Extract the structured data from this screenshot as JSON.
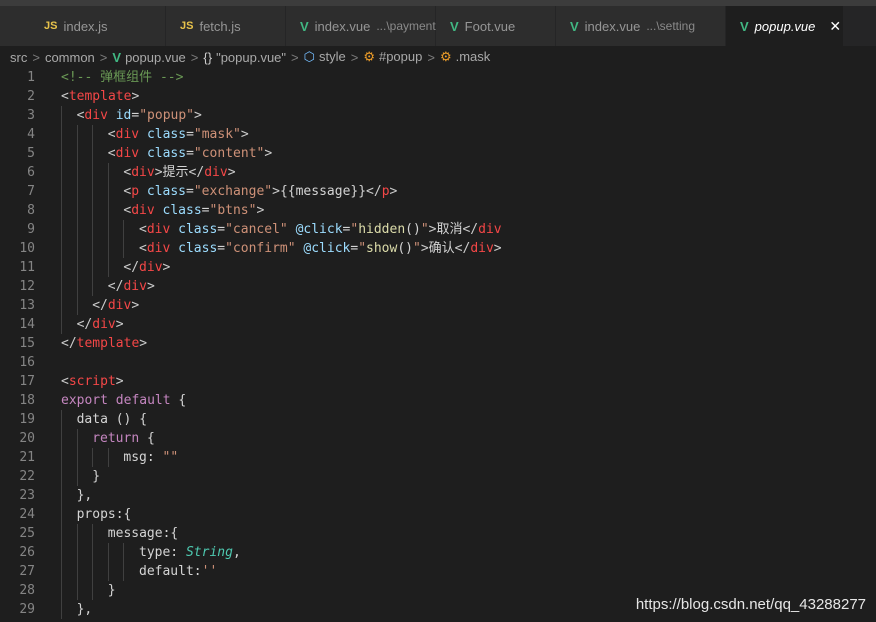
{
  "tabs": [
    {
      "icon": "JS",
      "kind": "js",
      "label": "index.js",
      "desc": "",
      "active": false
    },
    {
      "icon": "JS",
      "kind": "js",
      "label": "fetch.js",
      "desc": "",
      "active": false
    },
    {
      "icon": "V",
      "kind": "vue",
      "label": "index.vue",
      "desc": "...\\payment",
      "active": false
    },
    {
      "icon": "V",
      "kind": "vue",
      "label": "Foot.vue",
      "desc": "",
      "active": false
    },
    {
      "icon": "V",
      "kind": "vue",
      "label": "index.vue",
      "desc": "...\\setting",
      "active": false
    },
    {
      "icon": "V",
      "kind": "vue",
      "label": "popup.vue",
      "desc": "",
      "active": true,
      "close": "✕"
    }
  ],
  "breadcrumb": [
    {
      "label": "src",
      "icon": "",
      "kind": ""
    },
    {
      "label": "common",
      "icon": "",
      "kind": ""
    },
    {
      "label": "popup.vue",
      "icon": "V",
      "kind": "vue"
    },
    {
      "label": "\"popup.vue\"",
      "icon": "{}",
      "kind": "obj"
    },
    {
      "label": "style",
      "icon": "⬡",
      "kind": "cube"
    },
    {
      "label": "#popup",
      "icon": "⚙",
      "kind": "style"
    },
    {
      "label": ".mask",
      "icon": "⚙",
      "kind": "style"
    }
  ],
  "breadcrumb_sep": ">",
  "code_lines": [
    {
      "n": "1",
      "indent": 0,
      "tokens": [
        [
          "c",
          "<!-- 弹框组件 -->"
        ]
      ]
    },
    {
      "n": "2",
      "indent": 0,
      "tokens": [
        [
          "b",
          "<"
        ],
        [
          "t",
          "template"
        ],
        [
          "b",
          ">"
        ]
      ]
    },
    {
      "n": "3",
      "indent": 1,
      "tokens": [
        [
          "b",
          "<"
        ],
        [
          "t",
          "div"
        ],
        [
          "x",
          " "
        ],
        [
          "a",
          "id"
        ],
        [
          "x",
          "="
        ],
        [
          "s",
          "\"popup\""
        ],
        [
          "b",
          ">"
        ]
      ]
    },
    {
      "n": "4",
      "indent": 3,
      "tokens": [
        [
          "b",
          "<"
        ],
        [
          "t",
          "div"
        ],
        [
          "x",
          " "
        ],
        [
          "a",
          "class"
        ],
        [
          "x",
          "="
        ],
        [
          "s",
          "\"mask\""
        ],
        [
          "b",
          ">"
        ]
      ]
    },
    {
      "n": "5",
      "indent": 3,
      "tokens": [
        [
          "b",
          "<"
        ],
        [
          "t",
          "div"
        ],
        [
          "x",
          " "
        ],
        [
          "a",
          "class"
        ],
        [
          "x",
          "="
        ],
        [
          "s",
          "\"content\""
        ],
        [
          "b",
          ">"
        ]
      ]
    },
    {
      "n": "6",
      "indent": 4,
      "tokens": [
        [
          "b",
          "<"
        ],
        [
          "t",
          "div"
        ],
        [
          "b",
          ">"
        ],
        [
          "x",
          "提示"
        ],
        [
          "b",
          "</"
        ],
        [
          "t",
          "div"
        ],
        [
          "b",
          ">"
        ]
      ]
    },
    {
      "n": "7",
      "indent": 4,
      "tokens": [
        [
          "b",
          "<"
        ],
        [
          "t",
          "p"
        ],
        [
          "x",
          " "
        ],
        [
          "a",
          "class"
        ],
        [
          "x",
          "="
        ],
        [
          "s",
          "\"exchange\""
        ],
        [
          "b",
          ">"
        ],
        [
          "x",
          "{{message}}"
        ],
        [
          "b",
          "</"
        ],
        [
          "t",
          "p"
        ],
        [
          "b",
          ">"
        ]
      ]
    },
    {
      "n": "8",
      "indent": 4,
      "tokens": [
        [
          "b",
          "<"
        ],
        [
          "t",
          "div"
        ],
        [
          "x",
          " "
        ],
        [
          "a",
          "class"
        ],
        [
          "x",
          "="
        ],
        [
          "s",
          "\"btns\""
        ],
        [
          "b",
          ">"
        ]
      ]
    },
    {
      "n": "9",
      "indent": 5,
      "tokens": [
        [
          "b",
          "<"
        ],
        [
          "t",
          "div"
        ],
        [
          "x",
          " "
        ],
        [
          "a",
          "class"
        ],
        [
          "x",
          "="
        ],
        [
          "s",
          "\"cancel\""
        ],
        [
          "x",
          " "
        ],
        [
          "a",
          "@click"
        ],
        [
          "x",
          "="
        ],
        [
          "s",
          "\""
        ],
        [
          "f",
          "hidden"
        ],
        [
          "x",
          "()"
        ],
        [
          "s",
          "\""
        ],
        [
          "b",
          ">"
        ],
        [
          "x",
          "取消"
        ],
        [
          "b",
          "</"
        ],
        [
          "t",
          "div"
        ]
      ]
    },
    {
      "n": "10",
      "indent": 5,
      "tokens": [
        [
          "b",
          "<"
        ],
        [
          "t",
          "div"
        ],
        [
          "x",
          " "
        ],
        [
          "a",
          "class"
        ],
        [
          "x",
          "="
        ],
        [
          "s",
          "\"confirm\""
        ],
        [
          "x",
          " "
        ],
        [
          "a",
          "@click"
        ],
        [
          "x",
          "="
        ],
        [
          "s",
          "\""
        ],
        [
          "f",
          "show"
        ],
        [
          "x",
          "()"
        ],
        [
          "s",
          "\""
        ],
        [
          "b",
          ">"
        ],
        [
          "x",
          "确认"
        ],
        [
          "b",
          "</"
        ],
        [
          "t",
          "div"
        ],
        [
          "b",
          ">"
        ]
      ]
    },
    {
      "n": "11",
      "indent": 4,
      "tokens": [
        [
          "b",
          "</"
        ],
        [
          "t",
          "div"
        ],
        [
          "b",
          ">"
        ]
      ]
    },
    {
      "n": "12",
      "indent": 3,
      "tokens": [
        [
          "b",
          "</"
        ],
        [
          "t",
          "div"
        ],
        [
          "b",
          ">"
        ]
      ]
    },
    {
      "n": "13",
      "indent": 2,
      "tokens": [
        [
          "b",
          "</"
        ],
        [
          "t",
          "div"
        ],
        [
          "b",
          ">"
        ]
      ]
    },
    {
      "n": "14",
      "indent": 1,
      "tokens": [
        [
          "b",
          "</"
        ],
        [
          "t",
          "div"
        ],
        [
          "b",
          ">"
        ]
      ]
    },
    {
      "n": "15",
      "indent": 0,
      "tokens": [
        [
          "b",
          "</"
        ],
        [
          "t",
          "template"
        ],
        [
          "b",
          ">"
        ]
      ]
    },
    {
      "n": "16",
      "indent": 0,
      "tokens": []
    },
    {
      "n": "17",
      "indent": 0,
      "tokens": [
        [
          "b",
          "<"
        ],
        [
          "t",
          "script"
        ],
        [
          "b",
          ">"
        ]
      ]
    },
    {
      "n": "18",
      "indent": 0,
      "tokens": [
        [
          "k",
          "export"
        ],
        [
          "x",
          " "
        ],
        [
          "k",
          "default"
        ],
        [
          "x",
          " {"
        ]
      ]
    },
    {
      "n": "19",
      "indent": 1,
      "tokens": [
        [
          "x",
          "data () {"
        ]
      ]
    },
    {
      "n": "20",
      "indent": 2,
      "tokens": [
        [
          "k",
          "return"
        ],
        [
          "x",
          " {"
        ]
      ]
    },
    {
      "n": "21",
      "indent": 4,
      "tokens": [
        [
          "x",
          "msg: "
        ],
        [
          "s",
          "\"\""
        ]
      ]
    },
    {
      "n": "22",
      "indent": 2,
      "tokens": [
        [
          "x",
          "}"
        ]
      ]
    },
    {
      "n": "23",
      "indent": 1,
      "tokens": [
        [
          "x",
          "},"
        ]
      ]
    },
    {
      "n": "24",
      "indent": 1,
      "tokens": [
        [
          "x",
          "props:{"
        ]
      ]
    },
    {
      "n": "25",
      "indent": 3,
      "tokens": [
        [
          "x",
          "message:{"
        ]
      ]
    },
    {
      "n": "26",
      "indent": 5,
      "tokens": [
        [
          "x",
          "type: "
        ],
        [
          "y",
          "String"
        ],
        [
          "x",
          ","
        ]
      ]
    },
    {
      "n": "27",
      "indent": 5,
      "tokens": [
        [
          "x",
          "default:"
        ],
        [
          "s",
          "''"
        ]
      ]
    },
    {
      "n": "28",
      "indent": 3,
      "tokens": [
        [
          "x",
          "}"
        ]
      ]
    },
    {
      "n": "29",
      "indent": 1,
      "tokens": [
        [
          "x",
          "},"
        ]
      ]
    }
  ],
  "watermark": "https://blog.csdn.net/qq_43288277"
}
